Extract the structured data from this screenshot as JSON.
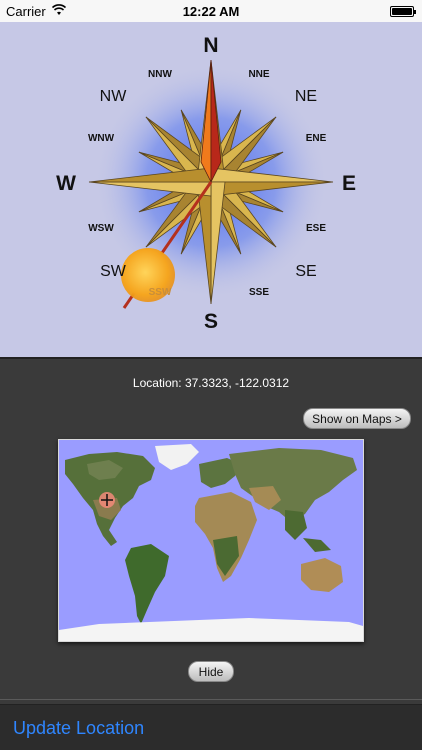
{
  "status_bar": {
    "carrier": "Carrier",
    "time": "12:22 AM"
  },
  "compass": {
    "directions": {
      "N": "N",
      "NNE": "NNE",
      "NE": "NE",
      "ENE": "ENE",
      "E": "E",
      "ESE": "ESE",
      "SE": "SE",
      "SSE": "SSE",
      "S": "S",
      "SSW": "SSW",
      "SW": "SW",
      "WSW": "WSW",
      "W": "W",
      "WNW": "WNW",
      "NW": "NW",
      "NNW": "NNW"
    },
    "colors": {
      "background": "#c6c8e6",
      "glow": "#6f86ee",
      "star_gold": "#d8b54a",
      "needle_red": "#c3341c",
      "sun": "#f5b326"
    }
  },
  "location": {
    "text": "Location:  37.3323,  -122.0312"
  },
  "buttons": {
    "show_on_maps": "Show on Maps >",
    "hide": "Hide"
  },
  "map": {
    "marker_icon": "crosshair-marker-icon",
    "ocean_color": "#9a9cff"
  },
  "bottom_bar": {
    "update_location": "Update Location",
    "accent_color": "#2f86ff"
  }
}
